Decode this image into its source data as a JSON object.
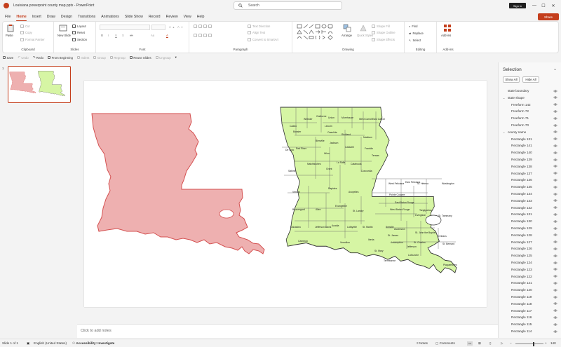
{
  "titlebar": {
    "document_title": "Louisiana powerpoint county map.pptx  -  PowerPoint",
    "search_placeholder": "Search",
    "signin_label": "Sign in",
    "minimize": "—",
    "maximize": "☐",
    "close": "✕"
  },
  "tabs": [
    "File",
    "Home",
    "Insert",
    "Draw",
    "Design",
    "Transitions",
    "Animations",
    "Slide Show",
    "Record",
    "Review",
    "View",
    "Help"
  ],
  "active_tab": "Home",
  "share_label": "Share",
  "ribbon": {
    "clipboard": {
      "paste": "Paste",
      "cut": "Cut",
      "copy": "Copy",
      "format_painter": "Format Painter",
      "label": "Clipboard"
    },
    "slides": {
      "new_slide": "New Slide",
      "layout": "Layout",
      "reset": "Reset",
      "section": "Section",
      "label": "Slides"
    },
    "font": {
      "label": "Font",
      "bold": "B",
      "italic": "I",
      "underline": "U",
      "strike": "S",
      "spacing": "ab",
      "case": "Aa"
    },
    "paragraph": {
      "text_direction": "Text Direction",
      "align_text": "Align Text",
      "smartart": "Convert to SmartArt",
      "label": "Paragraph"
    },
    "drawing": {
      "arrange": "Arrange",
      "quick_styles": "Quick Styles",
      "shape_fill": "Shape Fill",
      "shape_outline": "Shape Outline",
      "shape_effects": "Shape Effects",
      "label": "Drawing"
    },
    "editing": {
      "find": "Find",
      "replace": "Replace",
      "select": "Select",
      "label": "Editing"
    },
    "addins": {
      "addins": "Add-ins",
      "label": "Add-ins"
    }
  },
  "qat": {
    "save": "Save",
    "undo": "Undo",
    "redo": "Redo",
    "from_beginning": "From Beginning",
    "indent": "Indent",
    "group": "Group",
    "regroup": "Regroup",
    "reuse_slides": "Reuse Slides",
    "ungroup": "Ungroup"
  },
  "thumbnail": {
    "slide_number": "1"
  },
  "notes_placeholder": "Click to add notes",
  "selection_pane": {
    "title": "Selection",
    "show_all": "Show All",
    "hide_all": "Hide All",
    "items": [
      {
        "label": "state boundary",
        "level": 0
      },
      {
        "label": "state shape",
        "level": 0,
        "group": true
      },
      {
        "label": "Freeform 142",
        "level": 1
      },
      {
        "label": "Freeform 72",
        "level": 1
      },
      {
        "label": "Freeform 71",
        "level": 1
      },
      {
        "label": "Freeform 70",
        "level": 1
      },
      {
        "label": "county name",
        "level": 0,
        "group": true
      },
      {
        "label": "Rectangle 131",
        "level": 1
      },
      {
        "label": "Rectangle 141",
        "level": 1
      },
      {
        "label": "Rectangle 140",
        "level": 1
      },
      {
        "label": "Rectangle 139",
        "level": 1
      },
      {
        "label": "Rectangle 138",
        "level": 1
      },
      {
        "label": "Rectangle 137",
        "level": 1
      },
      {
        "label": "Rectangle 136",
        "level": 1
      },
      {
        "label": "Rectangle 135",
        "level": 1
      },
      {
        "label": "Rectangle 134",
        "level": 1
      },
      {
        "label": "Rectangle 133",
        "level": 1
      },
      {
        "label": "Rectangle 132",
        "level": 1
      },
      {
        "label": "Rectangle 131",
        "level": 1
      },
      {
        "label": "Rectangle 130",
        "level": 1
      },
      {
        "label": "Rectangle 129",
        "level": 1
      },
      {
        "label": "Rectangle 128",
        "level": 1
      },
      {
        "label": "Rectangle 127",
        "level": 1
      },
      {
        "label": "Rectangle 126",
        "level": 1
      },
      {
        "label": "Rectangle 125",
        "level": 1
      },
      {
        "label": "Rectangle 124",
        "level": 1
      },
      {
        "label": "Rectangle 123",
        "level": 1
      },
      {
        "label": "Rectangle 122",
        "level": 1
      },
      {
        "label": "Rectangle 121",
        "level": 1
      },
      {
        "label": "Rectangle 120",
        "level": 1
      },
      {
        "label": "Rectangle 119",
        "level": 1
      },
      {
        "label": "Rectangle 118",
        "level": 1
      },
      {
        "label": "Rectangle 117",
        "level": 1
      },
      {
        "label": "Rectangle 116",
        "level": 1
      },
      {
        "label": "Rectangle 115",
        "level": 1
      },
      {
        "label": "Rectangle 114",
        "level": 1
      }
    ]
  },
  "parishes": [
    "Caddo",
    "Bossier",
    "Webster",
    "Claiborne",
    "Union",
    "Morehouse",
    "West Carroll",
    "East Carroll",
    "Lincoln",
    "Ouachita",
    "Richland",
    "Madison",
    "Bienville",
    "Jackson",
    "De Soto",
    "Red River",
    "Caldwell",
    "Franklin",
    "Tensas",
    "Winn",
    "Natchitoches",
    "La Salle",
    "Catahoula",
    "Sabine",
    "Grant",
    "Concordia",
    "Rapides",
    "Avoyelles",
    "Vernon",
    "West Feliciana",
    "East Feliciana",
    "St. Helena",
    "Washington",
    "Pointe Coupee",
    "Beauregard",
    "Allen",
    "Evangeline",
    "St. Landry",
    "East Baton Rouge",
    "Livingston",
    "Tangipahoa",
    "West Baton Rouge",
    "St. Tammany",
    "Calcasieu",
    "Jefferson Davis",
    "Acadia",
    "Lafayette",
    "St. Martin",
    "Iberville",
    "Ascension",
    "St. John the Baptist",
    "St. James",
    "Orleans",
    "Cameron",
    "Vermilion",
    "Iberia",
    "Assumption",
    "St. Charles",
    "St. Bernard",
    "Jefferson",
    "St. Mary",
    "Lafourche",
    "Terrebonne",
    "Plaquemines"
  ],
  "statusbar": {
    "slide_of": "Slide 1 of 1",
    "language": "English (United States)",
    "accessibility": "Accessibility: Investigate",
    "notes": "Notes",
    "comments": "Comments",
    "zoom": "140"
  },
  "colors": {
    "accent": "#c43e1c",
    "state_fill": "#eeb0b0",
    "county_fill": "#d6f5a4"
  }
}
